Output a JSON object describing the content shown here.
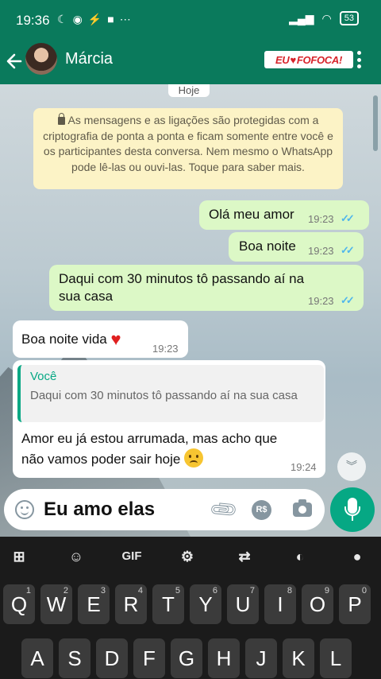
{
  "status_bar": {
    "time": "19:36",
    "left_icons": [
      "moon-icon",
      "whatsapp-status-icon",
      "messenger-icon",
      "video-icon",
      "dots-icon"
    ],
    "right_icons": [
      "signal-icon",
      "wifi-icon"
    ],
    "battery": "53"
  },
  "header": {
    "contact_name": "Márcia",
    "brand_logo": {
      "text_left": "EU",
      "text_right": "FOFOCA!"
    },
    "accent_color": "#0a7a5c"
  },
  "chat": {
    "date_chip": "Hoje",
    "encryption_notice": "As mensagens e as ligações são protegidas com a criptografia de ponta a ponta e ficam somente entre você e os participantes desta conversa. Nem mesmo o WhatsApp pode lê-las ou ouvi-las. Toque para saber mais.",
    "messages": [
      {
        "direction": "out",
        "text": "Olá meu amor",
        "time": "19:23",
        "status": "read"
      },
      {
        "direction": "out",
        "text": "Boa noite",
        "time": "19:23",
        "status": "read"
      },
      {
        "direction": "out",
        "text": "Daqui com 30 minutos tô passando aí na sua casa",
        "time": "19:23",
        "status": "read"
      },
      {
        "direction": "in",
        "text": "Boa noite vida",
        "emoji": "red-heart",
        "time": "19:23"
      },
      {
        "direction": "in",
        "text": "Amor eu já estou arrumada, mas acho que não vamos poder sair hoje",
        "emoji": "sad-face",
        "time": "19:24",
        "reply": {
          "author": "Você",
          "text": "Daqui com 30 minutos tô passando aí na sua casa"
        }
      }
    ]
  },
  "compose": {
    "input_value": "Eu amo elas",
    "pay_label": "R$"
  },
  "keyboard": {
    "toolbar": [
      "apps-icon",
      "sticker-icon",
      "GIF",
      "settings-icon",
      "translate-icon",
      "palette-icon",
      "mic-icon"
    ],
    "row1": [
      {
        "key": "Q",
        "hint": "1"
      },
      {
        "key": "W",
        "hint": "2"
      },
      {
        "key": "E",
        "hint": "3"
      },
      {
        "key": "R",
        "hint": "4"
      },
      {
        "key": "T",
        "hint": "5"
      },
      {
        "key": "Y",
        "hint": "6"
      },
      {
        "key": "U",
        "hint": "7"
      },
      {
        "key": "I",
        "hint": "8"
      },
      {
        "key": "O",
        "hint": "9"
      },
      {
        "key": "P",
        "hint": "0"
      }
    ],
    "row2": [
      "A",
      "S",
      "D",
      "F",
      "G",
      "H",
      "J",
      "K",
      "L"
    ]
  }
}
